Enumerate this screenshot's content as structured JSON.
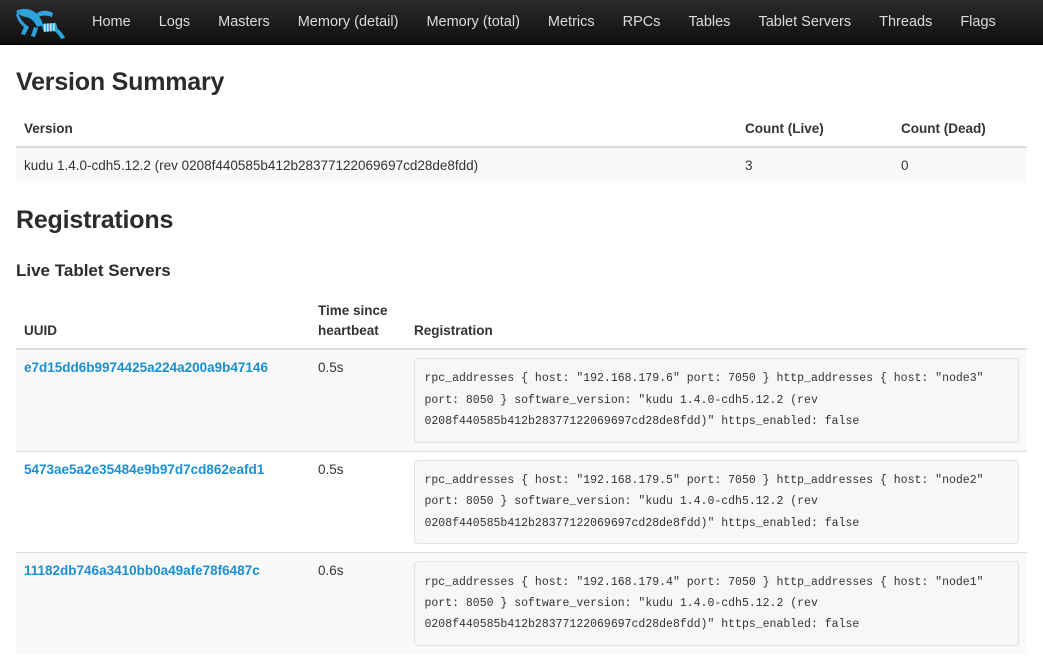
{
  "navbar": {
    "brand_icon": "kudu-antelope-logo",
    "brand_color": "#30a5dc",
    "items": [
      {
        "label": "Home"
      },
      {
        "label": "Logs"
      },
      {
        "label": "Masters"
      },
      {
        "label": "Memory (detail)"
      },
      {
        "label": "Memory (total)"
      },
      {
        "label": "Metrics"
      },
      {
        "label": "RPCs"
      },
      {
        "label": "Tables"
      },
      {
        "label": "Tablet Servers"
      },
      {
        "label": "Threads"
      },
      {
        "label": "Flags"
      }
    ]
  },
  "version_summary": {
    "heading": "Version Summary",
    "columns": {
      "version": "Version",
      "count_live": "Count (Live)",
      "count_dead": "Count (Dead)"
    },
    "rows": [
      {
        "version": "kudu 1.4.0-cdh5.12.2 (rev 0208f440585b412b28377122069697cd28de8fdd)",
        "count_live": "3",
        "count_dead": "0"
      }
    ]
  },
  "registrations": {
    "heading": "Registrations",
    "subheading": "Live Tablet Servers",
    "columns": {
      "uuid": "UUID",
      "heartbeat": "Time since heartbeat",
      "registration": "Registration"
    },
    "rows": [
      {
        "uuid": "e7d15dd6b9974425a224a200a9b47146",
        "heartbeat": "0.5s",
        "registration": "rpc_addresses { host: \"192.168.179.6\" port: 7050 } http_addresses { host: \"node3\" port: 8050 } software_version: \"kudu 1.4.0-cdh5.12.2 (rev 0208f440585b412b28377122069697cd28de8fdd)\" https_enabled: false"
      },
      {
        "uuid": "5473ae5a2e35484e9b97d7cd862eafd1",
        "heartbeat": "0.5s",
        "registration": "rpc_addresses { host: \"192.168.179.5\" port: 7050 } http_addresses { host: \"node2\" port: 8050 } software_version: \"kudu 1.4.0-cdh5.12.2 (rev 0208f440585b412b28377122069697cd28de8fdd)\" https_enabled: false"
      },
      {
        "uuid": "11182db746a3410bb0a49afe78f6487c",
        "heartbeat": "0.6s",
        "registration": "rpc_addresses { host: \"192.168.179.4\" port: 7050 } http_addresses { host: \"node1\" port: 8050 } software_version: \"kudu 1.4.0-cdh5.12.2 (rev 0208f440585b412b28377122069697cd28de8fdd)\" https_enabled: false"
      }
    ]
  }
}
